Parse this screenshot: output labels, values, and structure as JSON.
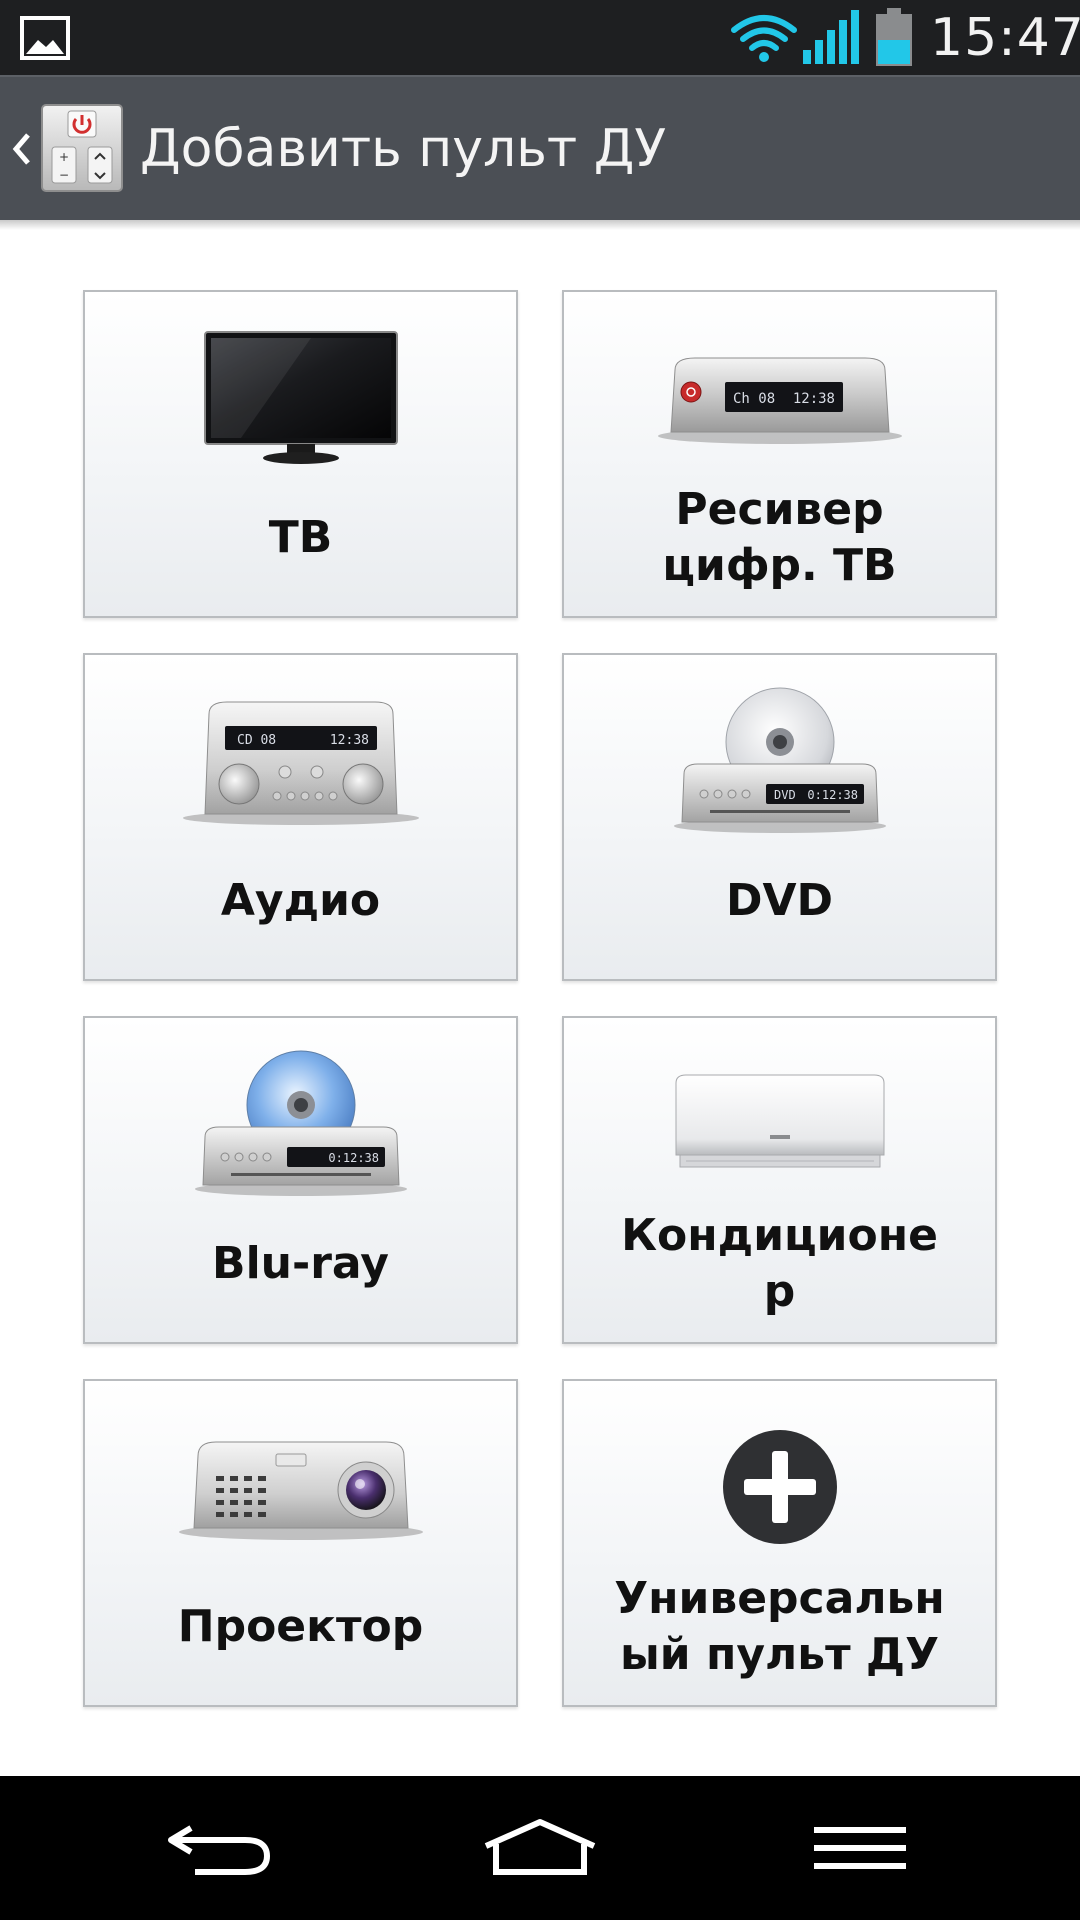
{
  "status_bar": {
    "time": "15:47",
    "icons": [
      "gallery-icon",
      "wifi-icon",
      "signal-icon",
      "battery-icon"
    ],
    "battery_color": "#22c7e8",
    "wifi_color": "#22c7e8"
  },
  "action_bar": {
    "title": "Добавить пульт ДУ",
    "background": "#4b4f55"
  },
  "devices": [
    {
      "id": "tv",
      "label": "ТВ",
      "icon": "tv-icon"
    },
    {
      "id": "receiver",
      "label_lines": [
        "Ресивер",
        "цифр. ТВ"
      ],
      "icon": "receiver-icon",
      "display": {
        "left": "Ch 08",
        "right": "12:38"
      }
    },
    {
      "id": "audio",
      "label": "Аудио",
      "icon": "audio-icon",
      "display": {
        "left": "CD 08",
        "right": "12:38"
      }
    },
    {
      "id": "dvd",
      "label": "DVD",
      "icon": "dvd-icon",
      "display": {
        "left": "DVD",
        "right": "0:12:38"
      }
    },
    {
      "id": "bluray",
      "label": "Blu-ray",
      "icon": "bluray-icon",
      "display": {
        "right": "0:12:38"
      }
    },
    {
      "id": "ac",
      "label_lines": [
        "Кондиционе",
        "р"
      ],
      "icon": "air-conditioner-icon"
    },
    {
      "id": "projector",
      "label": "Проектор",
      "icon": "projector-icon"
    },
    {
      "id": "universal",
      "label_lines": [
        "Универсальн",
        "ый пульт ДУ"
      ],
      "icon": "plus-icon"
    }
  ],
  "nav_bar": {
    "icons": [
      "back-icon",
      "home-icon",
      "menu-icon"
    ]
  }
}
